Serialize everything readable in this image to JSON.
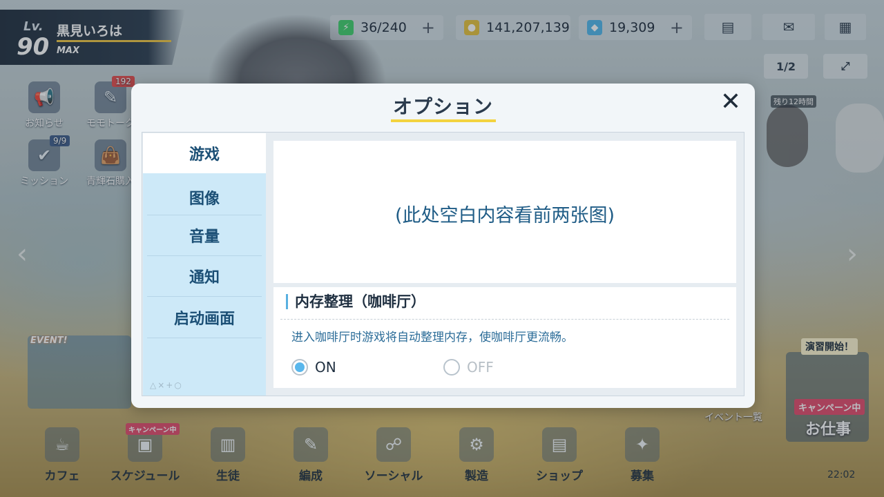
{
  "player": {
    "lv_label": "Lv.",
    "level": "90",
    "name": "黒見いろは",
    "max_label": "MAX"
  },
  "resources": {
    "ap": {
      "value": "36/240",
      "icon": "lightning-icon",
      "color": "#3fcf6a"
    },
    "credit": {
      "value": "141,207,139",
      "icon": "coin-icon",
      "color": "#e6c23a"
    },
    "gem": {
      "value": "19,309",
      "icon": "gem-icon",
      "color": "#4fb6ea"
    }
  },
  "top_buttons": {
    "page_indicator": "1/2"
  },
  "side_menu": [
    {
      "label": "お知らせ",
      "icon": "megaphone-icon"
    },
    {
      "label": "モモトーク",
      "icon": "chat-icon",
      "badge": "192"
    },
    {
      "label": "ミッション",
      "icon": "checklist-icon",
      "badge": "9/9"
    },
    {
      "label": "青輝石購入",
      "icon": "shop-bag-icon"
    }
  ],
  "event_banner": {
    "tag": "EVENT!"
  },
  "right_panel": {
    "char_label": "残り12時間",
    "task_start": "演習開始！",
    "task_campaign": "キャンペーン中",
    "task_label": "お仕事",
    "event_list": "イベント一覧"
  },
  "bottom_nav": [
    {
      "label": "カフェ",
      "icon": "cafe-cup-icon"
    },
    {
      "label": "スケジュール",
      "icon": "schedule-icon",
      "tag": "キャンペーン中"
    },
    {
      "label": "生徒",
      "icon": "student-card-icon"
    },
    {
      "label": "編成",
      "icon": "formation-icon"
    },
    {
      "label": "ソーシャル",
      "icon": "social-icon"
    },
    {
      "label": "製造",
      "icon": "craft-icon"
    },
    {
      "label": "ショップ",
      "icon": "shop-icon"
    },
    {
      "label": "募集",
      "icon": "recruit-bag-icon"
    }
  ],
  "clock": "22:02",
  "modal": {
    "title": "オプション",
    "tabs": [
      "游戏",
      "图像",
      "音量",
      "通知",
      "启动画面"
    ],
    "active_tab": "游戏",
    "tab_deco": "△×+○",
    "placeholder": "(此处空白内容看前两张图)",
    "section": {
      "title": "内存整理（咖啡厅）",
      "description": "进入咖啡厅时游戏将自动整理内存，使咖啡厅更流畅。",
      "options": [
        {
          "label": "ON",
          "selected": true
        },
        {
          "label": "OFF",
          "selected": false
        }
      ]
    }
  }
}
